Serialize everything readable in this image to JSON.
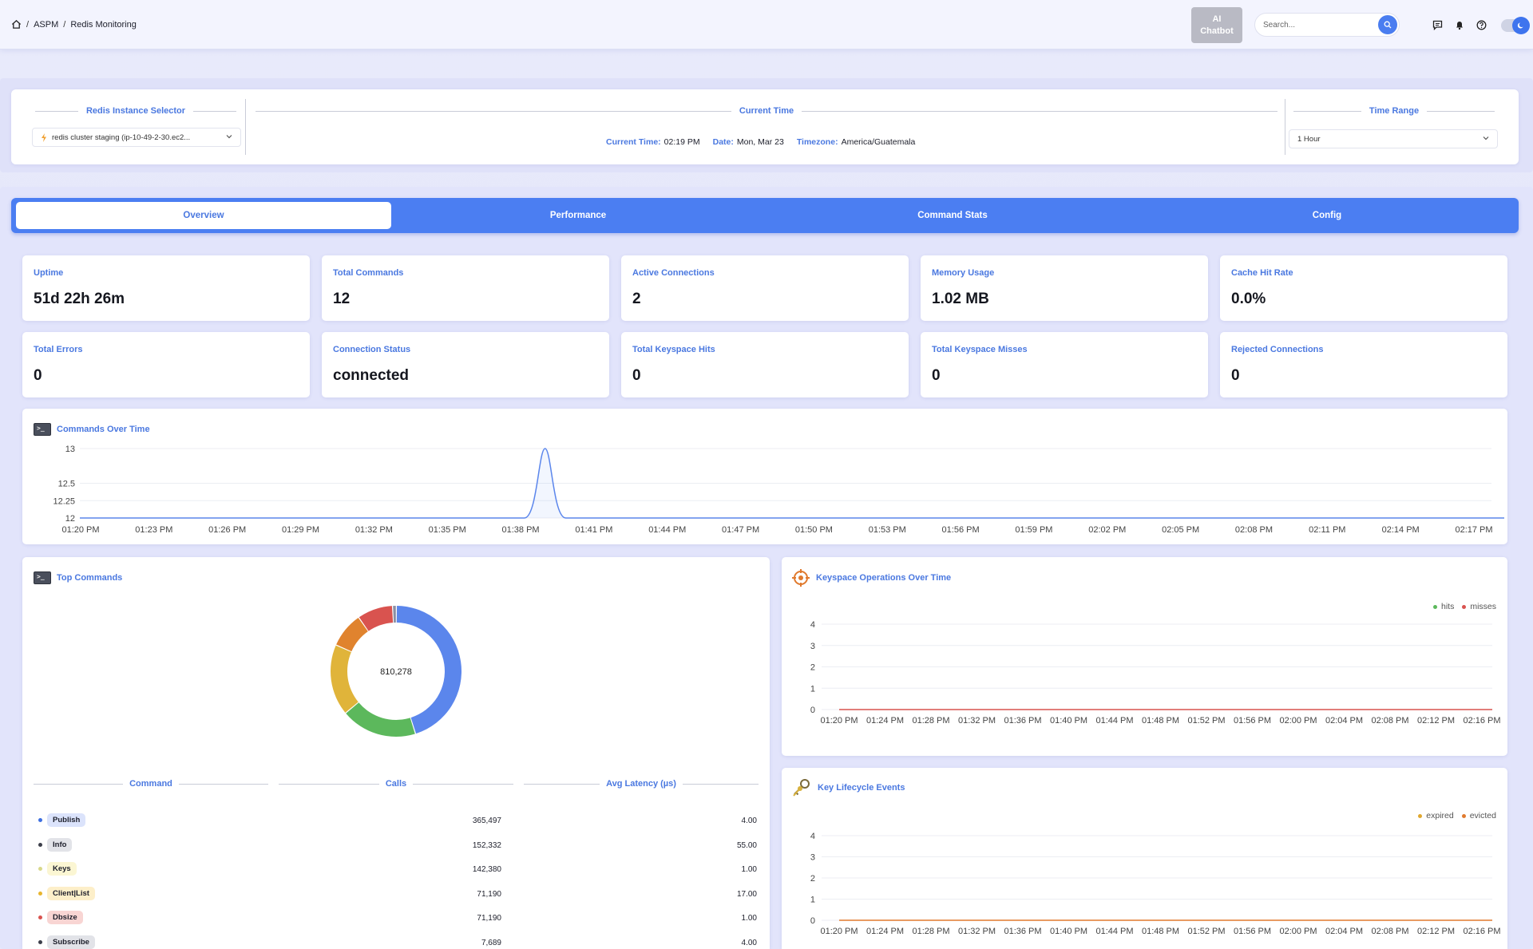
{
  "breadcrumb": [
    "ASPM",
    "Redis Monitoring"
  ],
  "topbar": {
    "ai_chatbot": "AI\nChatbot",
    "search_placeholder": "Search..."
  },
  "selector": {
    "instance_title": "Redis Instance Selector",
    "instance_value": "redis cluster staging (ip-10-49-2-30.ec2...",
    "current_time_title": "Current Time",
    "current_time_label": "Current Time:",
    "current_time_value": "02:19 PM",
    "date_label": "Date:",
    "date_value": "Mon, Mar 23",
    "timezone_label": "Timezone:",
    "timezone_value": "America/Guatemala",
    "time_range_title": "Time Range",
    "time_range_value": "1 Hour"
  },
  "tabs": [
    "Overview",
    "Performance",
    "Command Stats",
    "Config"
  ],
  "active_tab": "Overview",
  "stats": [
    {
      "label": "Uptime",
      "value": "51d 22h 26m"
    },
    {
      "label": "Total Commands",
      "value": "12"
    },
    {
      "label": "Active Connections",
      "value": "2"
    },
    {
      "label": "Memory Usage",
      "value": "1.02 MB"
    },
    {
      "label": "Cache Hit Rate",
      "value": "0.0%"
    },
    {
      "label": "Total Errors",
      "value": "0"
    },
    {
      "label": "Connection Status",
      "value": "connected"
    },
    {
      "label": "Total Keyspace Hits",
      "value": "0"
    },
    {
      "label": "Total Keyspace Misses",
      "value": "0"
    },
    {
      "label": "Rejected Connections",
      "value": "0"
    }
  ],
  "colors": {
    "accent": "#4a78e0",
    "tab_bar": "#4b7ef2",
    "hits": "#5cb85c",
    "misses": "#d9534f",
    "expired": "#e0a72e",
    "evicted": "#e07a2e"
  },
  "chart_data": [
    {
      "type": "line",
      "title": "Commands Over Time",
      "x": [
        "01:20 PM",
        "01:23 PM",
        "01:26 PM",
        "01:29 PM",
        "01:32 PM",
        "01:35 PM",
        "01:38 PM",
        "01:41 PM",
        "01:44 PM",
        "01:47 PM",
        "01:50 PM",
        "01:53 PM",
        "01:56 PM",
        "01:59 PM",
        "02:02 PM",
        "02:05 PM",
        "02:08 PM",
        "02:11 PM",
        "02:14 PM",
        "02:17 PM"
      ],
      "series": [
        {
          "values": [
            12,
            12,
            12,
            12,
            12,
            12,
            12,
            12,
            12,
            12,
            12,
            12,
            12,
            12,
            12,
            12,
            12,
            12,
            12,
            12
          ]
        }
      ],
      "peak": {
        "x": "01:39 PM",
        "y": 13
      },
      "ylim": [
        12,
        13
      ],
      "yticks": [
        "13",
        "12.5",
        "12.25",
        "12"
      ],
      "grid": true
    },
    {
      "type": "pie",
      "title": "Top Commands",
      "center_label": "810,278",
      "slices": [
        {
          "name": "Publish",
          "value": 365497,
          "color": "#5b86ec"
        },
        {
          "name": "Info",
          "value": 152332,
          "color": "#5cb85c"
        },
        {
          "name": "Keys",
          "value": 142380,
          "color": "#e0b43a"
        },
        {
          "name": "Client|List",
          "value": 71190,
          "color": "#e0832e"
        },
        {
          "name": "Dbsize",
          "value": 71190,
          "color": "#d9534f"
        },
        {
          "name": "Subscribe",
          "value": 7689,
          "color": "#8a8fa3"
        }
      ]
    },
    {
      "type": "line",
      "title": "Keyspace Operations Over Time",
      "x": [
        "01:20 PM",
        "01:24 PM",
        "01:28 PM",
        "01:32 PM",
        "01:36 PM",
        "01:40 PM",
        "01:44 PM",
        "01:48 PM",
        "01:52 PM",
        "01:56 PM",
        "02:00 PM",
        "02:04 PM",
        "02:08 PM",
        "02:12 PM",
        "02:16 PM"
      ],
      "series": [
        {
          "name": "hits",
          "values": [
            0,
            0,
            0,
            0,
            0,
            0,
            0,
            0,
            0,
            0,
            0,
            0,
            0,
            0,
            0
          ]
        },
        {
          "name": "misses",
          "values": [
            0,
            0,
            0,
            0,
            0,
            0,
            0,
            0,
            0,
            0,
            0,
            0,
            0,
            0,
            0
          ]
        }
      ],
      "ylim": [
        0,
        4
      ],
      "yticks": [
        "4",
        "3",
        "2",
        "1",
        "0"
      ],
      "legend": "top-right",
      "grid": true
    },
    {
      "type": "line",
      "title": "Key Lifecycle Events",
      "x": [
        "01:20 PM",
        "01:24 PM",
        "01:28 PM",
        "01:32 PM",
        "01:36 PM",
        "01:40 PM",
        "01:44 PM",
        "01:48 PM",
        "01:52 PM",
        "01:56 PM",
        "02:00 PM",
        "02:04 PM",
        "02:08 PM",
        "02:12 PM",
        "02:16 PM"
      ],
      "series": [
        {
          "name": "expired",
          "values": [
            0,
            0,
            0,
            0,
            0,
            0,
            0,
            0,
            0,
            0,
            0,
            0,
            0,
            0,
            0
          ]
        },
        {
          "name": "evicted",
          "values": [
            0,
            0,
            0,
            0,
            0,
            0,
            0,
            0,
            0,
            0,
            0,
            0,
            0,
            0,
            0
          ]
        }
      ],
      "ylim": [
        0,
        4
      ],
      "yticks": [
        "4",
        "3",
        "2",
        "1",
        "0"
      ],
      "legend": "top-right",
      "grid": true
    }
  ],
  "top_commands_table": {
    "headers": [
      "Command",
      "Calls",
      "Avg Latency (µs)"
    ],
    "rows": [
      {
        "command": "Publish",
        "calls": "365,497",
        "latency": "4.00",
        "dot": "#3e6fe0",
        "pill": "#dbe3fb"
      },
      {
        "command": "Info",
        "calls": "152,332",
        "latency": "55.00",
        "dot": "#3c3f4a",
        "pill": "#e2e3e8"
      },
      {
        "command": "Keys",
        "calls": "142,380",
        "latency": "1.00",
        "dot": "#d8d88a",
        "pill": "#fbf6d3"
      },
      {
        "command": "Client|List",
        "calls": "71,190",
        "latency": "17.00",
        "dot": "#e8b52e",
        "pill": "#fdefc9"
      },
      {
        "command": "Dbsize",
        "calls": "71,190",
        "latency": "1.00",
        "dot": "#d9534f",
        "pill": "#f8d5d3"
      },
      {
        "command": "Subscribe",
        "calls": "7,689",
        "latency": "4.00",
        "dot": "#3c3f4a",
        "pill": "#e2e3e8"
      }
    ]
  }
}
